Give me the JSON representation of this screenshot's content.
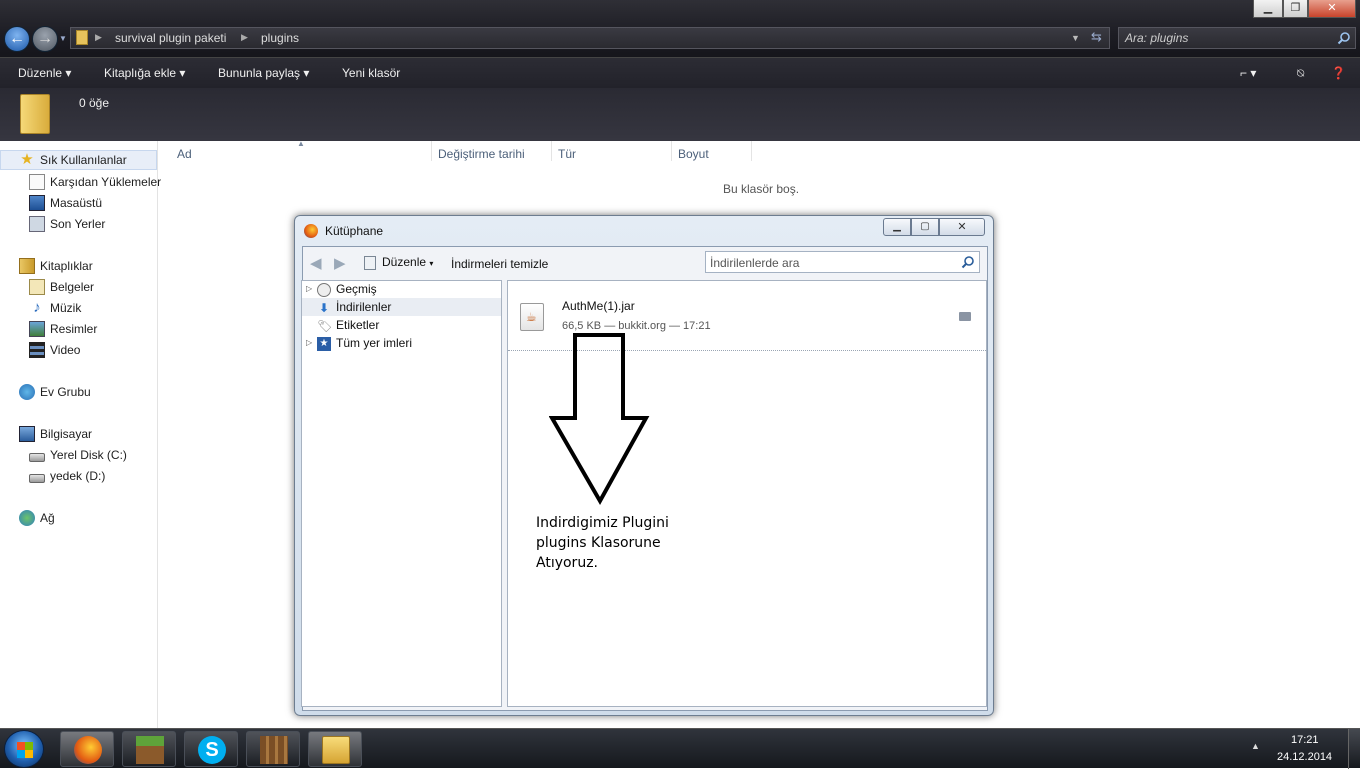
{
  "explorer": {
    "breadcrumb": [
      "survival plugin paketi",
      "plugins"
    ],
    "search_placeholder": "Ara: plugins",
    "toolbar": {
      "organize": "Düzenle",
      "add_to_library": "Kitaplığa ekle",
      "share_with": "Bununla paylaş",
      "new_folder": "Yeni klasör"
    },
    "details": {
      "item_count": "0 öğe"
    },
    "columns": [
      "Ad",
      "Değiştirme tarihi",
      "Tür",
      "Boyut"
    ],
    "empty_message": "Bu klasör boş.",
    "sidebar": {
      "favorites": {
        "label": "Sık Kullanılanlar",
        "items": [
          "Karşıdan Yüklemeler",
          "Masaüstü",
          "Son Yerler"
        ]
      },
      "libraries": {
        "label": "Kitaplıklar",
        "items": [
          "Belgeler",
          "Müzik",
          "Resimler",
          "Video"
        ]
      },
      "homegroup": {
        "label": "Ev Grubu"
      },
      "computer": {
        "label": "Bilgisayar",
        "items": [
          "Yerel Disk (C:)",
          "yedek (D:)"
        ]
      },
      "network": {
        "label": "Ağ"
      }
    }
  },
  "library_window": {
    "title": "Kütüphane",
    "organize": "Düzenle",
    "clear_downloads": "İndirmeleri temizle",
    "search_placeholder": "İndirilenlerde ara",
    "tree": [
      "Geçmiş",
      "İndirilenler",
      "Etiketler",
      "Tüm yer imleri"
    ],
    "download": {
      "name": "AuthMe(1).jar",
      "info": "66,5 KB — bukkit.org — 17:21"
    }
  },
  "annotation": {
    "lines": [
      "Indirdigimiz Plugini",
      "plugins Klasorune",
      "Atıyoruz."
    ]
  },
  "taskbar": {
    "time": "17:21",
    "date": "24.12.2014"
  },
  "colors": {
    "accent": "#3b78c4",
    "dark_chrome": "#2a2a33",
    "selection": "#e8eef8"
  }
}
